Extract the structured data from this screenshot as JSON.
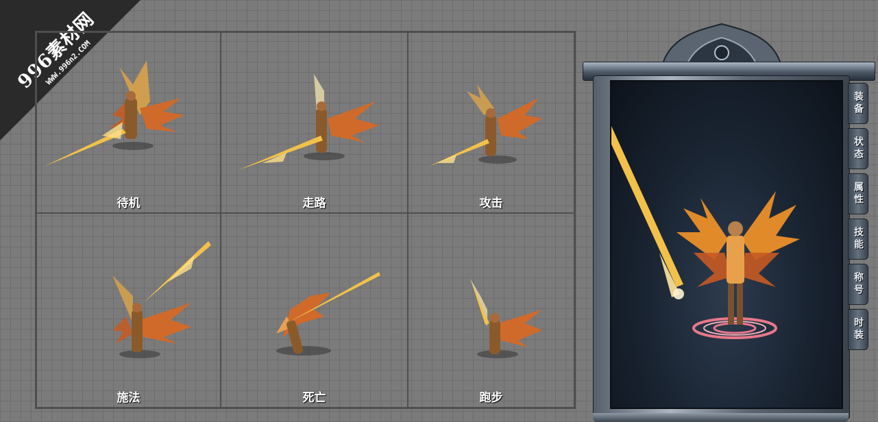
{
  "watermark": {
    "title": "996素材网",
    "url": "WWW.996n2.COM"
  },
  "animations": [
    {
      "label": "待机"
    },
    {
      "label": "走路"
    },
    {
      "label": "攻击"
    },
    {
      "label": "施法"
    },
    {
      "label": "死亡"
    },
    {
      "label": "跑步"
    }
  ],
  "panel": {
    "tabs": [
      "装备",
      "状态",
      "属性",
      "技能",
      "称号",
      "时装"
    ]
  },
  "colors": {
    "grid_bg": "#7b7b7b",
    "wing_orange": "#e0782a",
    "gold": "#f2c14a",
    "panel_dark": "#18222f"
  }
}
